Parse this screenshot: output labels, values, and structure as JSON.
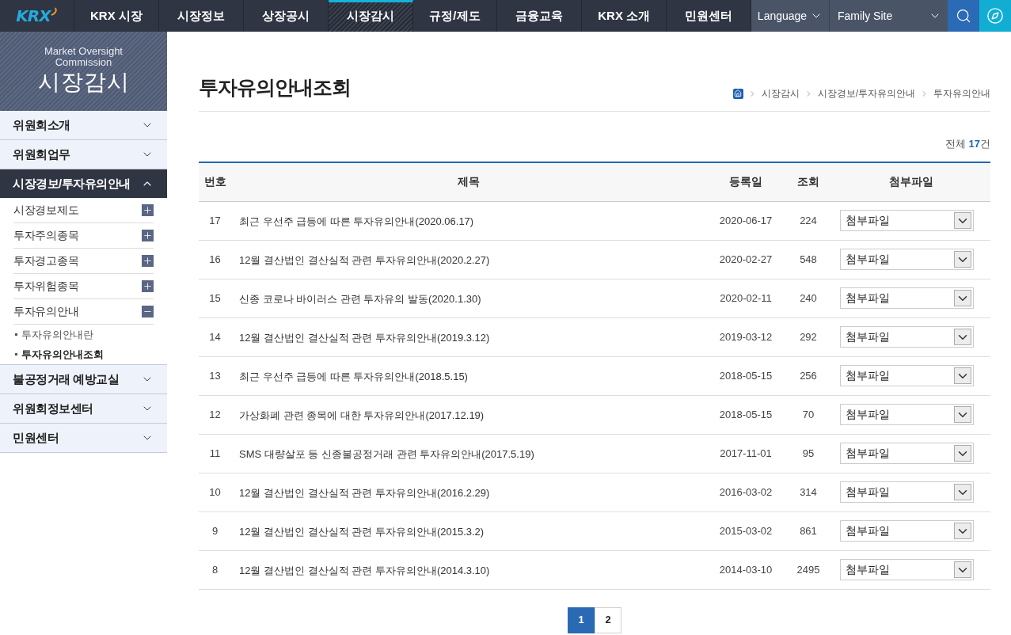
{
  "header": {
    "logo": "KRX",
    "nav": [
      {
        "label": "KRX 시장",
        "selected": false
      },
      {
        "label": "시장정보",
        "selected": false
      },
      {
        "label": "상장공시",
        "selected": false
      },
      {
        "label": "시장감시",
        "selected": true
      },
      {
        "label": "규정/제도",
        "selected": false
      },
      {
        "label": "금융교육",
        "selected": false
      },
      {
        "label": "KRX 소개",
        "selected": false
      },
      {
        "label": "민원센터",
        "selected": false
      }
    ],
    "language": "Language",
    "family_site": "Family Site"
  },
  "sidebar": {
    "banner": {
      "subtitle": "Market Oversight Commission",
      "title": "시장감시"
    },
    "menu": [
      {
        "label": "위원회소개",
        "expanded": false
      },
      {
        "label": "위원회업무",
        "expanded": false
      },
      {
        "label": "시장경보/투자유의안내",
        "expanded": true,
        "children": [
          {
            "label": "시장경보제도",
            "expanded": false
          },
          {
            "label": "투자주의종목",
            "expanded": false
          },
          {
            "label": "투자경고종목",
            "expanded": false
          },
          {
            "label": "투자위험종목",
            "expanded": false
          },
          {
            "label": "투자유의안내",
            "expanded": true,
            "children": [
              {
                "label": "투자유의안내란",
                "selected": false
              },
              {
                "label": "투자유의안내조회",
                "selected": true
              }
            ]
          }
        ]
      },
      {
        "label": "불공정거래 예방교실",
        "expanded": false
      },
      {
        "label": "위원회정보센터",
        "expanded": false
      },
      {
        "label": "민원센터",
        "expanded": false
      }
    ]
  },
  "page": {
    "title": "투자유의안내조회",
    "breadcrumb": [
      "시장감시",
      "시장경보/투자유의안내",
      "투자유의안내"
    ],
    "total": "전체 **17**건"
  },
  "table": {
    "columns": [
      "번호",
      "제목",
      "등록일",
      "조회",
      "첨부파일"
    ],
    "rows": [
      {
        "no": "17",
        "title": "최근 우선주 급등에 따른 투자유의안내(2020.06.17)",
        "date": "2020-06-17",
        "views": "224",
        "attachment": "첨부파일"
      },
      {
        "no": "16",
        "title": "12월 결산법인 결산실적 관련 투자유의안내(2020.2.27)",
        "date": "2020-02-27",
        "views": "548",
        "attachment": "첨부파일"
      },
      {
        "no": "15",
        "title": "신종 코로나 바이러스 관련 투자유의 발동(2020.1.30)",
        "date": "2020-02-11",
        "views": "240",
        "attachment": "첨부파일"
      },
      {
        "no": "14",
        "title": "12월 결산법인 결산실적 관련 투자유의안내(2019.3.12)",
        "date": "2019-03-12",
        "views": "292",
        "attachment": "첨부파일"
      },
      {
        "no": "13",
        "title": "최근 우선주 급등에 따른 투자유의안내(2018.5.15)",
        "date": "2018-05-15",
        "views": "256",
        "attachment": "첨부파일"
      },
      {
        "no": "12",
        "title": "가상화폐 관련 종목에 대한 투자유의안내(2017.12.19)",
        "date": "2018-05-15",
        "views": "70",
        "attachment": "첨부파일"
      },
      {
        "no": "11",
        "title": "SMS 대량살포 등 신종불공정거래 관련 투자유의안내(2017.5.19)",
        "date": "2017-11-01",
        "views": "95",
        "attachment": "첨부파일"
      },
      {
        "no": "10",
        "title": "12월 결산법인 결산실적 관련 투자유의안내(2016.2.29)",
        "date": "2016-03-02",
        "views": "314",
        "attachment": "첨부파일"
      },
      {
        "no": "9",
        "title": "12월 결산법인 결산실적 관련 투자유의안내(2015.3.2)",
        "date": "2015-03-02",
        "views": "861",
        "attachment": "첨부파일"
      },
      {
        "no": "8",
        "title": "12월 결산법인 결산실적 관련 투자유의안내(2014.3.10)",
        "date": "2014-03-10",
        "views": "2495",
        "attachment": "첨부파일"
      }
    ]
  },
  "pagination": [
    {
      "label": "1",
      "selected": true
    },
    {
      "label": "2",
      "selected": false
    }
  ]
}
